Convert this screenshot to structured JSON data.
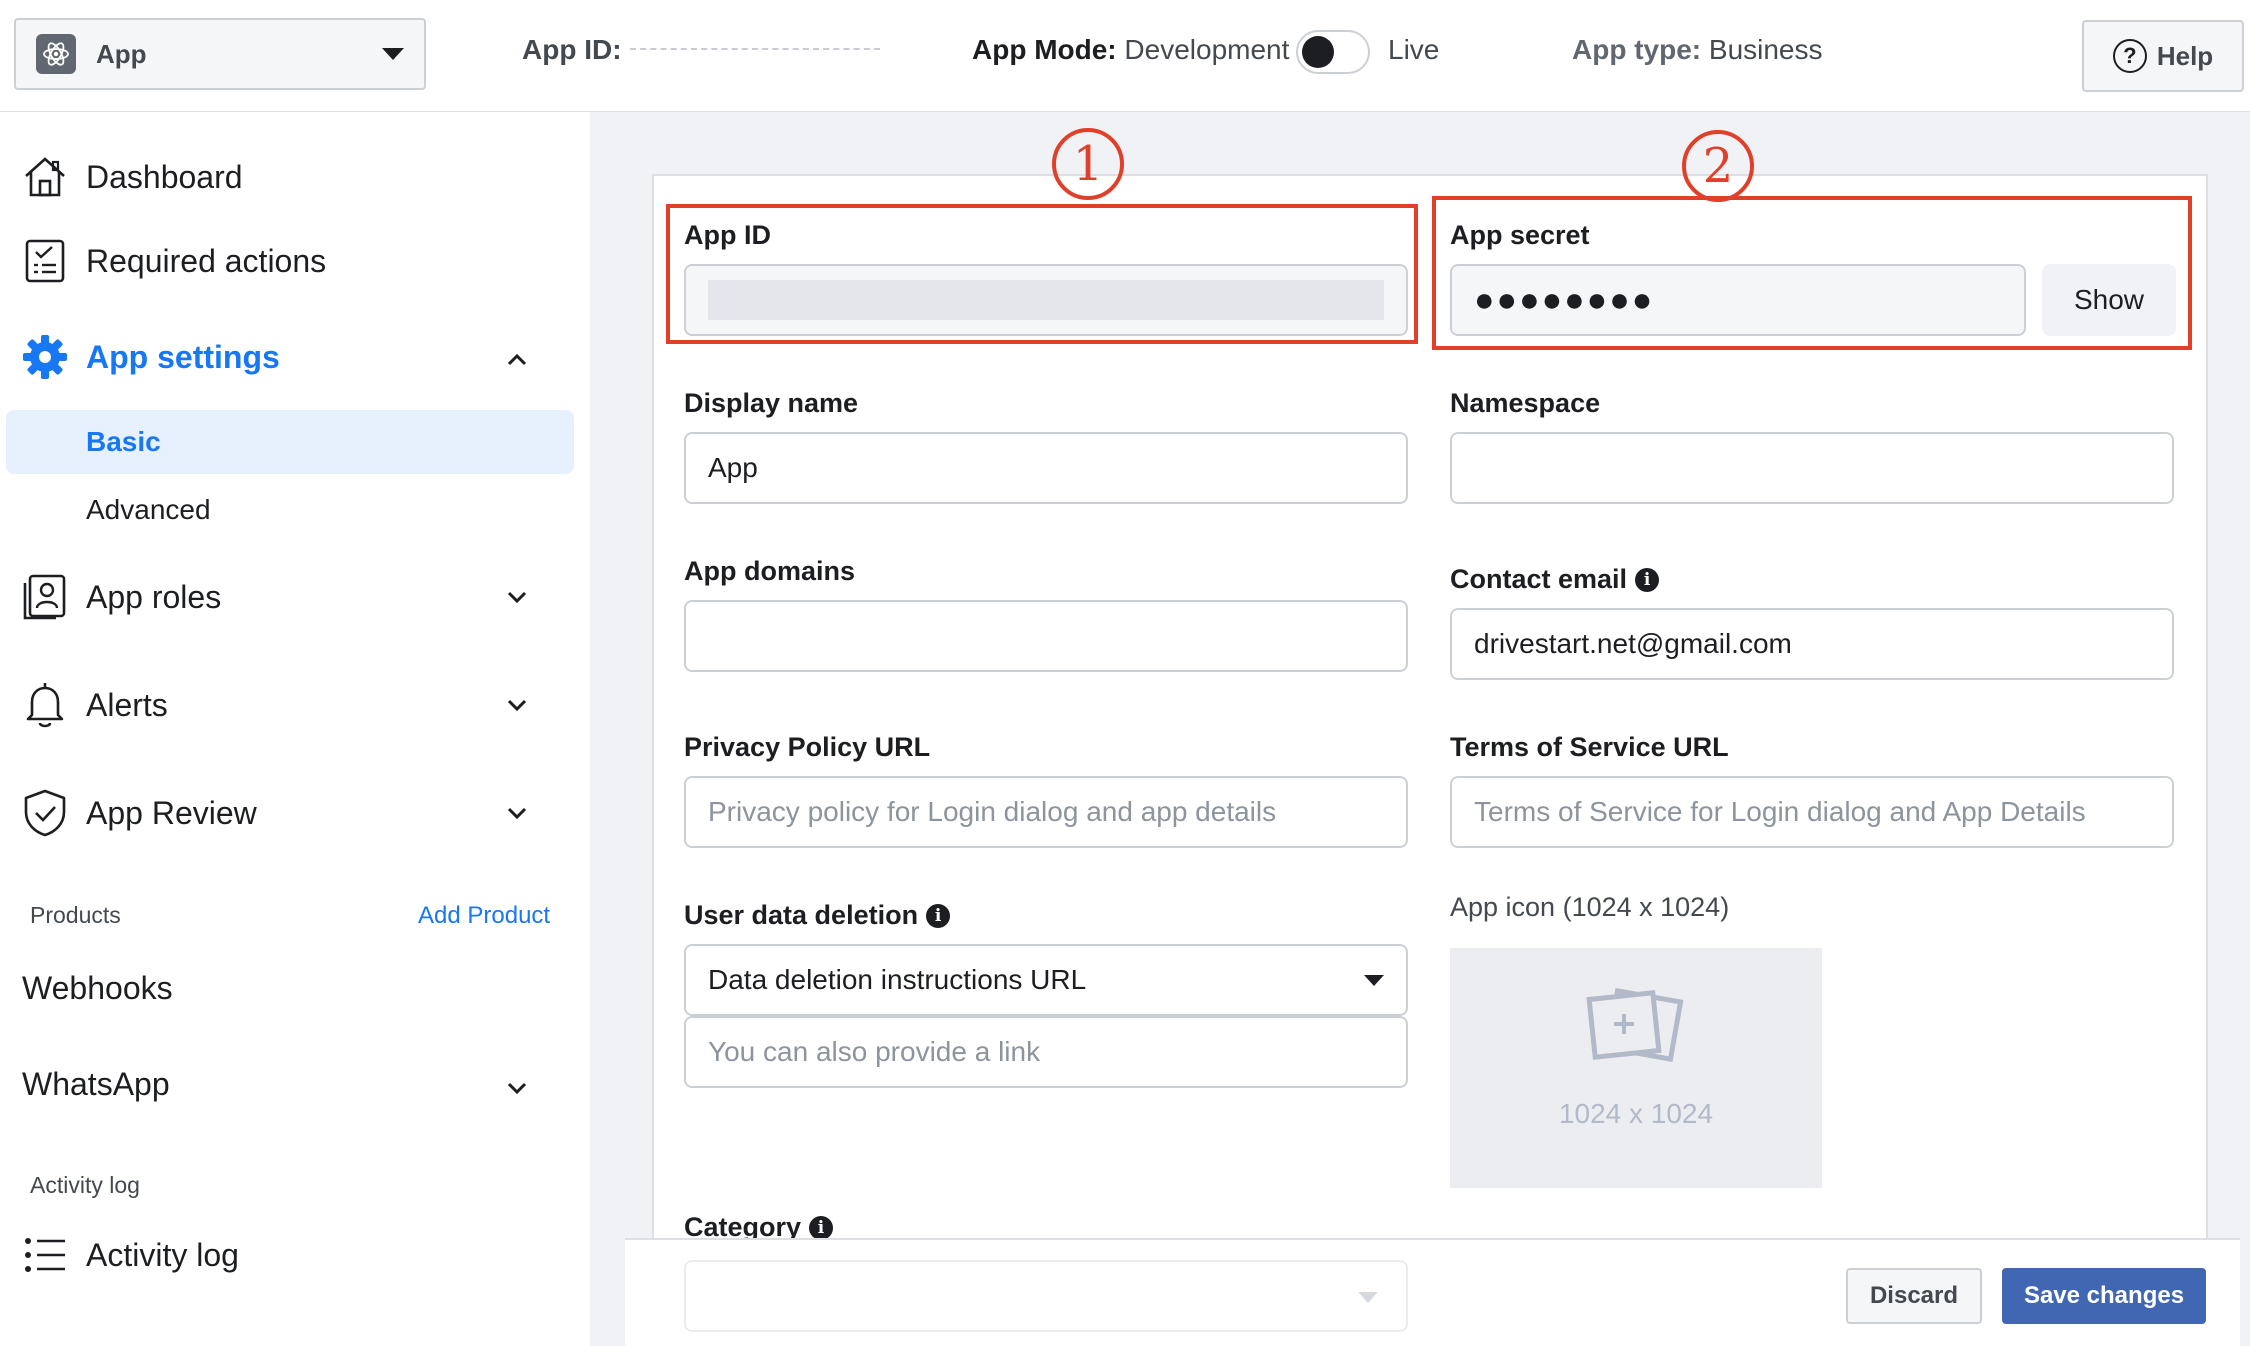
{
  "topbar": {
    "app_name": "App",
    "app_id_label": "App ID:",
    "app_mode_label": "App Mode:",
    "app_mode_value": "Development",
    "live_label": "Live",
    "app_type_label": "App type:",
    "app_type_value": "Business",
    "help_label": "Help",
    "live_toggle_on": false
  },
  "sidebar": {
    "dashboard": "Dashboard",
    "required_actions": "Required actions",
    "app_settings": "App settings",
    "basic": "Basic",
    "advanced": "Advanced",
    "app_roles": "App roles",
    "alerts": "Alerts",
    "app_review": "App Review",
    "products_label": "Products",
    "add_product": "Add Product",
    "webhooks": "Webhooks",
    "whatsapp": "WhatsApp",
    "activity_log_section": "Activity log",
    "activity_log": "Activity log"
  },
  "form": {
    "app_id_label": "App ID",
    "app_secret_label": "App secret",
    "app_secret_value": "●●●●●●●●",
    "show_button": "Show",
    "display_name_label": "Display name",
    "display_name_value": "App",
    "namespace_label": "Namespace",
    "namespace_value": "",
    "app_domains_label": "App domains",
    "app_domains_value": "",
    "contact_email_label": "Contact email",
    "contact_email_value": "drivestart.net@gmail.com",
    "privacy_label": "Privacy Policy URL",
    "privacy_placeholder": "Privacy policy for Login dialog and app details",
    "tos_label": "Terms of Service URL",
    "tos_placeholder": "Terms of Service for Login dialog and App Details",
    "user_data_label": "User data deletion",
    "user_data_select": "Data deletion instructions URL",
    "user_data_placeholder": "You can also provide a link",
    "app_icon_label": "App icon (1024 x 1024)",
    "app_icon_size": "1024 x 1024",
    "category_label": "Category"
  },
  "annotations": {
    "marker_1": "1",
    "marker_2": "2",
    "color": "#e0402a"
  },
  "footer": {
    "discard": "Discard",
    "save": "Save changes"
  },
  "colors": {
    "accent": "#1877f2",
    "save_button": "#4267b2"
  }
}
